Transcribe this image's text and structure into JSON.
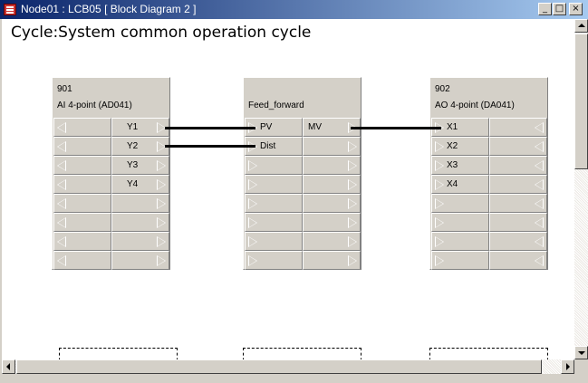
{
  "window": {
    "title": "Node01 : LCB05  [ Block Diagram 2 ]",
    "buttons": {
      "minimize": "_",
      "maximize": "□",
      "close": "×"
    }
  },
  "diagram": {
    "cycle_label": "Cycle:System common operation cycle",
    "blocks": [
      {
        "id": "901",
        "name": "AI 4-point (AD041)",
        "rows": [
          [
            "",
            "Y1"
          ],
          [
            "",
            "Y2"
          ],
          [
            "",
            "Y3"
          ],
          [
            "",
            "Y4"
          ],
          [
            "",
            ""
          ],
          [
            "",
            ""
          ],
          [
            "",
            ""
          ],
          [
            "",
            ""
          ]
        ]
      },
      {
        "id": "",
        "name": "Feed_forward",
        "rows": [
          [
            "PV",
            "MV"
          ],
          [
            "Dist",
            ""
          ],
          [
            "",
            ""
          ],
          [
            "",
            ""
          ],
          [
            "",
            ""
          ],
          [
            "",
            ""
          ],
          [
            "",
            ""
          ],
          [
            "",
            ""
          ]
        ]
      },
      {
        "id": "902",
        "name": "AO 4-point (DA041)",
        "rows": [
          [
            "X1",
            ""
          ],
          [
            "X2",
            ""
          ],
          [
            "X3",
            ""
          ],
          [
            "X4",
            ""
          ],
          [
            "",
            ""
          ],
          [
            "",
            ""
          ],
          [
            "",
            ""
          ],
          [
            "",
            ""
          ]
        ]
      }
    ],
    "connections": [
      {
        "from": "901.Y1",
        "to": "Feed_forward.PV"
      },
      {
        "from": "901.Y2",
        "to": "Feed_forward.Dist"
      },
      {
        "from": "Feed_forward.MV",
        "to": "902.X1"
      }
    ]
  }
}
